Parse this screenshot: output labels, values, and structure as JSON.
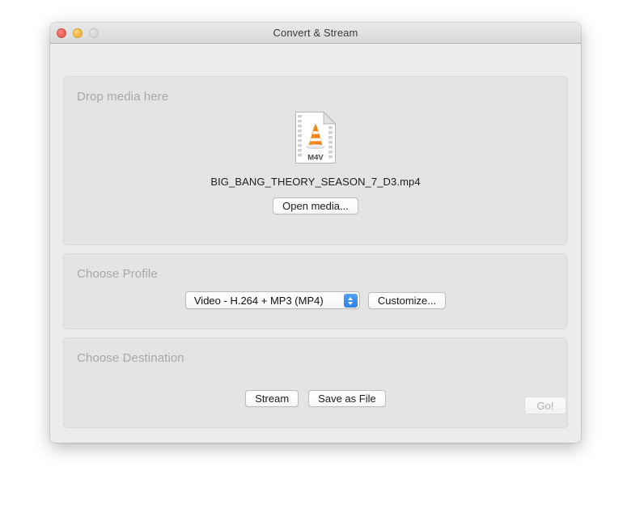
{
  "window": {
    "title": "Convert & Stream",
    "traffic_lights": [
      {
        "name": "close",
        "label": "Close",
        "color": "#ef6b60",
        "enabled": true
      },
      {
        "name": "minimize",
        "label": "Minimize",
        "color": "#fcbf4d",
        "enabled": true
      },
      {
        "name": "zoom",
        "label": "Zoom",
        "color": "#dcdcdc",
        "enabled": false
      }
    ]
  },
  "media_panel": {
    "title": "Drop media here",
    "file_icon": {
      "icon_name": "vlc-m4v-file-icon",
      "badge_text": "M4V"
    },
    "file_name": "BIG_BANG_THEORY_SEASON_7_D3.mp4",
    "open_button": "Open media..."
  },
  "profile_panel": {
    "title": "Choose Profile",
    "selected_profile": "Video - H.264 + MP3 (MP4)",
    "customize_button": "Customize...",
    "stepper_color": "#3b90ef"
  },
  "destination_panel": {
    "title": "Choose Destination",
    "stream_button": "Stream",
    "save_button": "Save as File"
  },
  "footer": {
    "go_button": "Go!",
    "go_enabled": false
  },
  "colors": {
    "window_bg": "#ececec",
    "panel_bg": "#e4e4e4",
    "panel_border": "#dadada",
    "title_text": "#3a3a3a",
    "section_label": "#a8a8a8",
    "accent_blue": "#3b90ef",
    "vlc_orange": "#f2861e"
  }
}
